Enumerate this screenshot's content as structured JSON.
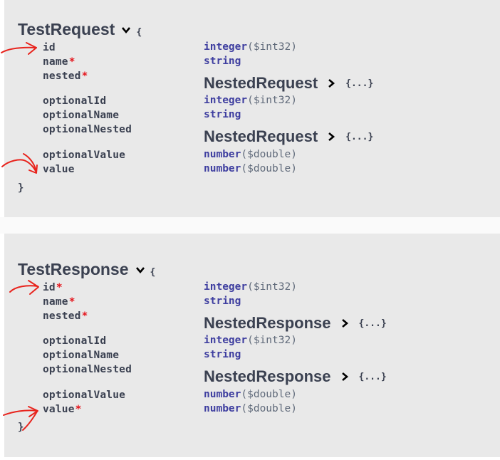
{
  "models": [
    {
      "title": "TestRequest",
      "open_brace": "{",
      "close_brace": "}",
      "properties": [
        {
          "name": "id",
          "required": false,
          "type": "integer",
          "format": "($int32)"
        },
        {
          "name": "name",
          "required": true,
          "type": "string",
          "format": ""
        },
        {
          "name": "nested",
          "required": true,
          "ref": "NestedRequest",
          "ref_body": "{...}"
        },
        {
          "name": "optionalId",
          "required": false,
          "type": "integer",
          "format": "($int32)"
        },
        {
          "name": "optionalName",
          "required": false,
          "type": "string",
          "format": ""
        },
        {
          "name": "optionalNested",
          "required": false,
          "ref": "NestedRequest",
          "ref_body": "{...}"
        },
        {
          "name": "optionalValue",
          "required": false,
          "type": "number",
          "format": "($double)"
        },
        {
          "name": "value",
          "required": false,
          "type": "number",
          "format": "($double)"
        }
      ]
    },
    {
      "title": "TestResponse",
      "open_brace": "{",
      "close_brace": "}",
      "properties": [
        {
          "name": "id",
          "required": true,
          "type": "integer",
          "format": "($int32)"
        },
        {
          "name": "name",
          "required": true,
          "type": "string",
          "format": ""
        },
        {
          "name": "nested",
          "required": true,
          "ref": "NestedResponse",
          "ref_body": "{...}"
        },
        {
          "name": "optionalId",
          "required": false,
          "type": "integer",
          "format": "($int32)"
        },
        {
          "name": "optionalName",
          "required": false,
          "type": "string",
          "format": ""
        },
        {
          "name": "optionalNested",
          "required": false,
          "ref": "NestedResponse",
          "ref_body": "{...}"
        },
        {
          "name": "optionalValue",
          "required": false,
          "type": "number",
          "format": "($double)"
        },
        {
          "name": "value",
          "required": true,
          "type": "number",
          "format": "($double)"
        }
      ]
    }
  ],
  "required_marker": "*",
  "colors": {
    "panel": "#e9e9e9",
    "text": "#3b4151",
    "type": "#3f3fa0",
    "required": "#e5141b",
    "annotation": "#e8231c"
  },
  "icons": [
    "chevron-down-icon",
    "chevron-right-icon",
    "red-arrow-annotation"
  ]
}
